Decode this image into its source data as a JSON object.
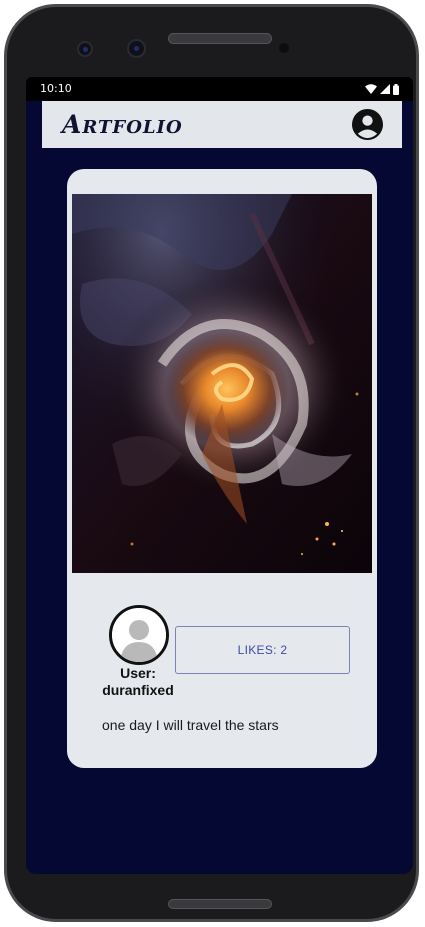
{
  "status_bar": {
    "time": "10:10",
    "icons": [
      "wifi-icon",
      "signal-icon",
      "battery-icon"
    ]
  },
  "app_bar": {
    "title": "Artfolio",
    "account_icon": "account-circle-icon"
  },
  "post": {
    "user_label": "User:",
    "username": "duranfixed",
    "likes_label": "LIKES: 2",
    "caption": "one day I will travel the stars"
  },
  "colors": {
    "screen_bg": "#050833",
    "card_bg": "#e5e9ee",
    "appbar_bg": "#e3e7ec",
    "likes_accent": "#3f4aa0"
  }
}
